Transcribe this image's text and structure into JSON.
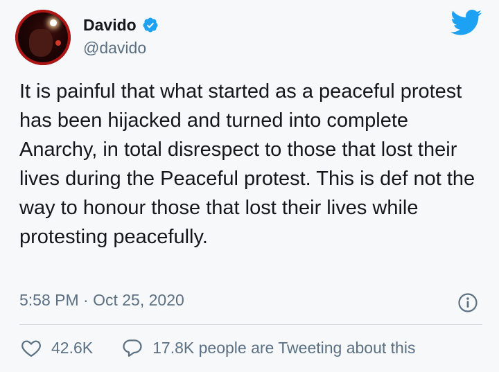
{
  "tweet": {
    "author": {
      "display_name": "Davido",
      "handle": "@davido",
      "verified": true
    },
    "text": "It is painful that what started as a peaceful protest has been hijacked and turned into complete Anarchy, in total disrespect to those that lost their lives during the Peaceful protest. This is def not the way to honour those that lost their lives while protesting peacefully.",
    "timestamp": "5:58 PM · Oct 25, 2020",
    "likes": "42.6K",
    "tweeting_about": "17.8K people are Tweeting about this"
  },
  "icons": {
    "verified": "verified-badge-icon",
    "brand": "twitter-bird-icon",
    "info": "info-icon",
    "like": "heart-icon",
    "reply": "speech-bubble-icon"
  },
  "colors": {
    "twitter_blue": "#1da1f2",
    "text_primary": "#14171a",
    "text_secondary": "#5b7083"
  }
}
